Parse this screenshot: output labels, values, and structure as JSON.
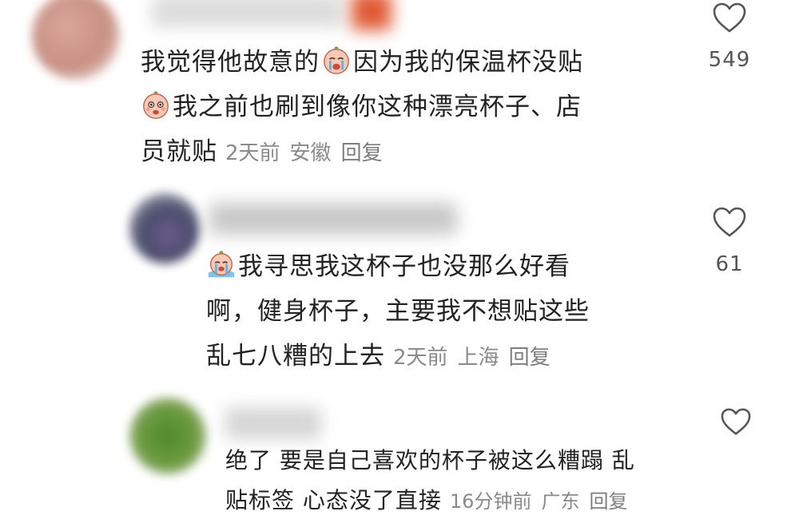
{
  "comments": [
    {
      "line1_a": "我觉得他故意的",
      "line1_b": "因为我的保温杯没贴",
      "line2": "我之前也刷到像你这种漂亮杯子、店",
      "line3": "员就贴",
      "time": "2天前",
      "location": "安徽",
      "reply_label": "回复",
      "likes": "549",
      "emoji_a": "crying-face-emoji",
      "emoji_b": "shocked-face-emoji"
    },
    {
      "line1": "我寻思我这杯子也没那么好看",
      "line2": "啊，健身杯子，主要我不想贴这些",
      "line3": "乱七八糟的上去",
      "time": "2天前",
      "location": "上海",
      "reply_label": "回复",
      "likes": "61",
      "emoji_a": "crying-rain-face-emoji"
    },
    {
      "line1": "绝了 要是自己喜欢的杯子被这么糟蹋 乱",
      "line2": "贴标签 心态没了直接",
      "time": "16分钟前",
      "location": "广东",
      "reply_label": "回复",
      "likes": ""
    }
  ],
  "colors": {
    "text": "#222222",
    "meta": "#8a8a8a",
    "icon": "#555555"
  }
}
